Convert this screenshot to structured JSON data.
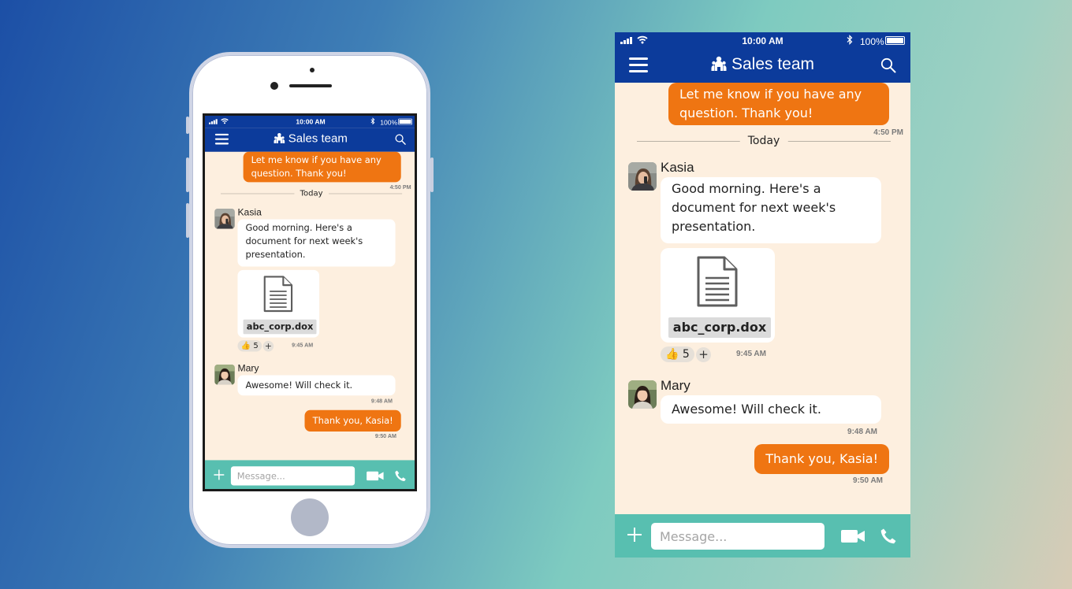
{
  "status_bar": {
    "time": "10:00 AM",
    "battery": "100%"
  },
  "header": {
    "title": "Sales team"
  },
  "messages": {
    "outgoing_1": {
      "text": "Let me know if you have any question. Thank you!",
      "time": "4:50 PM"
    },
    "divider": "Today",
    "kasia": {
      "name": "Kasia",
      "text": "Good morning. Here's a document for next week's presentation.",
      "file_name": "abc_corp.dox",
      "reaction_emoji": "👍",
      "reaction_count": "5",
      "add_reaction": "+",
      "time": "9:45 AM"
    },
    "mary": {
      "name": "Mary",
      "text": "Awesome! Will check it.",
      "time": "9:48 AM"
    },
    "outgoing_2": {
      "text": "Thank you, Kasia!",
      "time": "9:50 AM"
    }
  },
  "composer": {
    "placeholder": "Message..."
  },
  "icons": {
    "menu": "hamburger-menu-icon",
    "group": "group-people-icon",
    "search": "search-icon",
    "document": "document-icon",
    "attach": "plus-icon",
    "video": "video-camera-icon",
    "phone": "phone-icon"
  },
  "colors": {
    "header": "#0c3b9b",
    "outgoing_bubble": "#ef7512",
    "chat_background": "#fdefdf",
    "composer_bar": "#58bfb0"
  }
}
